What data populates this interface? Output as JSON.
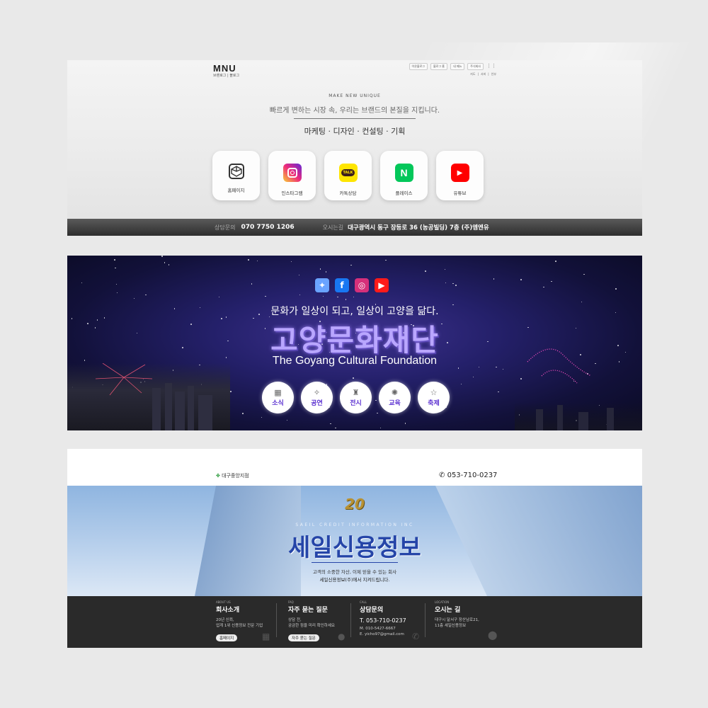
{
  "panel1": {
    "logo": "MNU",
    "sublinks": "브랜로그 | 블로그",
    "topnav": [
      "이온블로그",
      "블로그 홈",
      "내 메뉴",
      "주식회사"
    ],
    "langnav": [
      "지도",
      "서비",
      "인부"
    ],
    "tagline_en": "MAKE NEW UNIQUE",
    "tagline_ko": "빠르게 변하는 시장 속, 우리는 브랜드의 본질을 지킵니다.",
    "services": "마케팅 · 디자인 · 컨설팅 · 기획",
    "cards": [
      {
        "label": "홈페이지",
        "icon": "cube-logo-icon"
      },
      {
        "label": "인스타그램",
        "icon": "instagram-icon"
      },
      {
        "label": "카톡상담",
        "icon": "kakaotalk-icon",
        "glyph": "TALK"
      },
      {
        "label": "플레이스",
        "icon": "naver-icon",
        "glyph": "N"
      },
      {
        "label": "유튜브",
        "icon": "youtube-icon",
        "glyph": "▶"
      }
    ],
    "bar": {
      "phone_label": "상담문의",
      "phone": "070 7750 1206",
      "address_label": "오시는길",
      "address": "대구광역시 동구 장등로 36 (농공빌딩) 7층 (주)엠엔유"
    }
  },
  "panel2": {
    "social": [
      {
        "icon": "daum-icon",
        "glyph": "✦",
        "color": "#6aa3ff"
      },
      {
        "icon": "facebook-icon",
        "glyph": "f",
        "color": "#1877f2"
      },
      {
        "icon": "instagram-icon",
        "glyph": "◎",
        "color": "#d6307a"
      },
      {
        "icon": "youtube-icon",
        "glyph": "▶",
        "color": "#ff1a1a"
      }
    ],
    "slogan": "문화가 일상이 되고, 일상이 고양을 닮다.",
    "title": "고양문화재단",
    "title_en": "The Goyang Cultural Foundation",
    "circles": [
      {
        "label": "소식",
        "icon": "calendar-icon",
        "glyph": "▦"
      },
      {
        "label": "공연",
        "icon": "stars-icon",
        "glyph": "✧"
      },
      {
        "label": "전시",
        "icon": "trophy-icon",
        "glyph": "♜"
      },
      {
        "label": "교육",
        "icon": "gear-icon",
        "glyph": "✺"
      },
      {
        "label": "축제",
        "icon": "star-icon",
        "glyph": "☆"
      }
    ]
  },
  "panel3": {
    "branch": "대구중앙지점",
    "phone_top": "053-710-0237",
    "badge": "20",
    "en": "SAEIL CREDIT INFORMATION INC",
    "title": "세일신용정보",
    "desc1": "고객의 소중한 자산, 이제 믿을 수 있는 회사",
    "desc2": "세일신용정보(주)에서 지켜드립니다.",
    "footer": [
      {
        "en": "ABOUT US",
        "heading": "회사소개",
        "lines": [
          "20년 신뢰,",
          "업계 1위 신용정보 전문 기업"
        ],
        "button": "홈페이지"
      },
      {
        "en": "FAQ",
        "heading": "자주 묻는 질문",
        "lines": [
          "상담 전,",
          "궁금한 점을 미리 확인하세요"
        ],
        "button": "자주 묻는 질문"
      },
      {
        "en": "CALL",
        "heading": "상담문의",
        "phone": "T. 053-710-0237",
        "lines": [
          "M. 010-5427-6667",
          "E. yicho97@gmail.com"
        ]
      },
      {
        "en": "LOCATION",
        "heading": "오시는 길",
        "lines": [
          "대구시 달서구 장산남로21,",
          "11층 세일신용정보"
        ]
      }
    ]
  }
}
